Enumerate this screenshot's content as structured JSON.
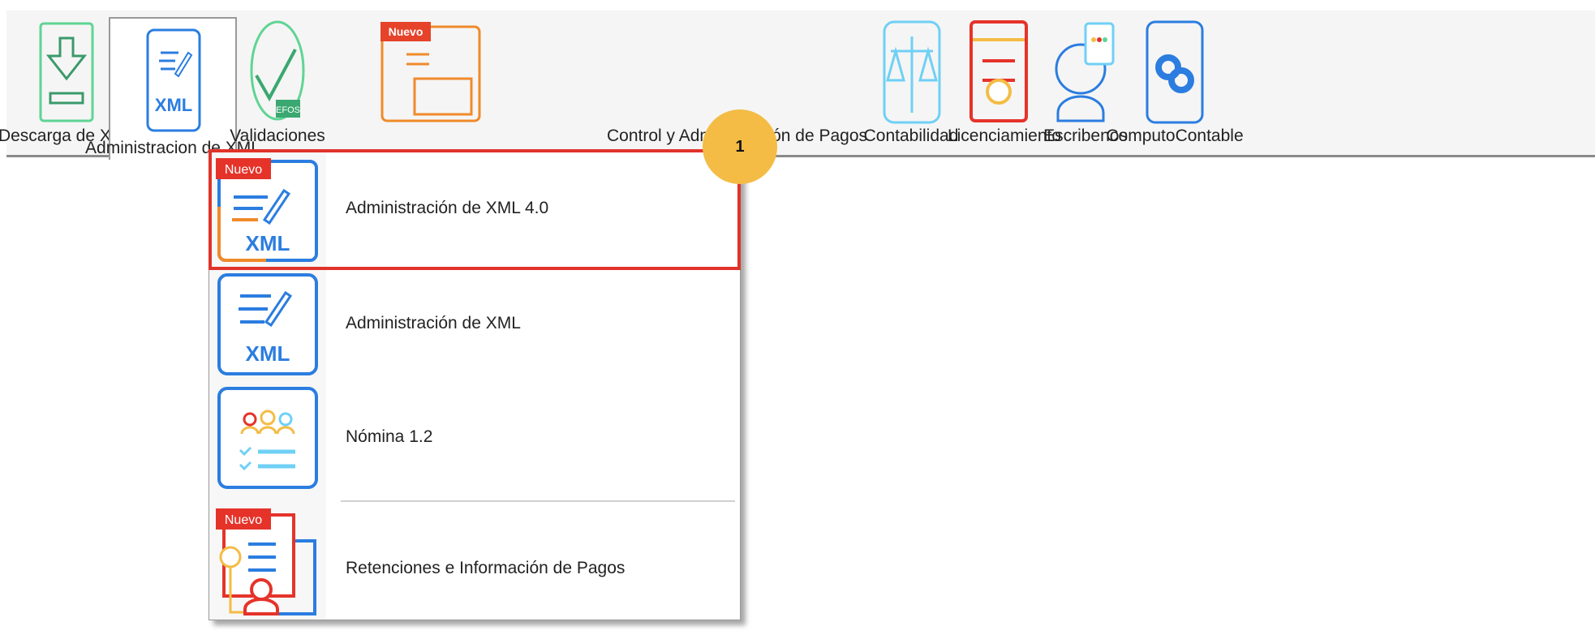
{
  "toolbar": {
    "items": [
      {
        "label": "Descarga de XML",
        "icon": "download-icon"
      },
      {
        "label": "Administracion de XML",
        "icon": "xml-edit-icon",
        "selected": true
      },
      {
        "label": "Validaciones",
        "icon": "check-efos-icon",
        "badge": "EFOS"
      },
      {
        "label": "Control y Administración de Pagos",
        "icon": "payments-icon",
        "badge": "Nuevo"
      },
      {
        "label": "Contabilidad",
        "icon": "scale-icon"
      },
      {
        "label": "Licenciamiento",
        "icon": "certificate-icon"
      },
      {
        "label": "Escribenos",
        "icon": "chat-user-icon"
      },
      {
        "label": "ComputoContable",
        "icon": "infinity-logo-icon"
      }
    ]
  },
  "menu": {
    "items": [
      {
        "label": "Administración de XML 4.0",
        "badge": "Nuevo",
        "icon_text": "XML",
        "highlighted": true
      },
      {
        "label": "Administración de XML",
        "icon_text": "XML"
      },
      {
        "label": "Nómina 1.2"
      },
      {
        "label": "Retenciones e Información de Pagos",
        "badge": "Nuevo"
      }
    ]
  },
  "annotation": {
    "step": "1"
  },
  "colors": {
    "highlight": "#e0332a",
    "marker": "#f4bc45",
    "blue": "#2b7de0",
    "green": "#5fd494",
    "red": "#e5332a"
  }
}
